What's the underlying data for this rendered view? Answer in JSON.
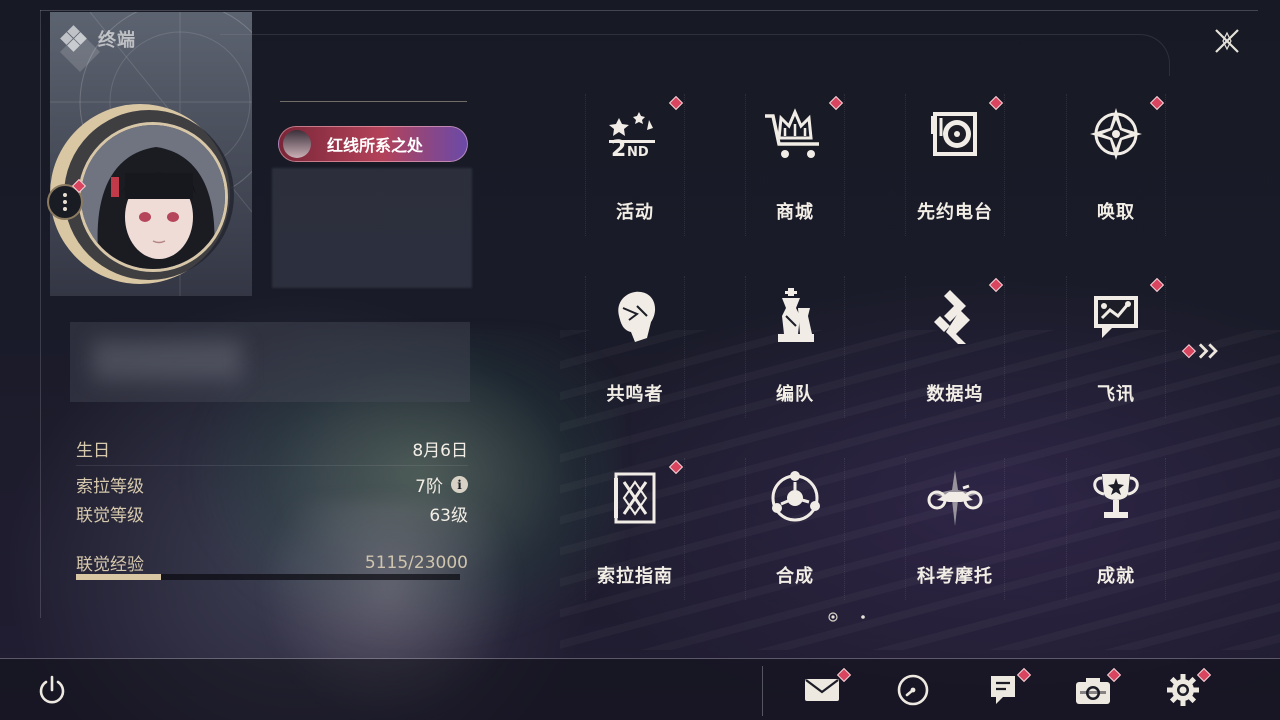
{
  "header": {
    "title": "终端"
  },
  "profile": {
    "title_badge": "红线所系之处",
    "stats": [
      {
        "label": "生日",
        "value": "8月6日"
      },
      {
        "label": "索拉等级",
        "value": "7阶"
      },
      {
        "label": "联觉等级",
        "value": "63级"
      }
    ],
    "exp": {
      "label": "联觉经验",
      "current": 5115,
      "max": 23000,
      "display": "5115/23000"
    }
  },
  "menu": {
    "items": [
      {
        "label": "活动",
        "icon": "event-2nd-icon",
        "badge": true
      },
      {
        "label": "商城",
        "icon": "crown-cart-icon",
        "badge": true
      },
      {
        "label": "先约电台",
        "icon": "radio-turntable-icon",
        "badge": true
      },
      {
        "label": "唤取",
        "icon": "compass-star-icon",
        "badge": true
      },
      {
        "label": "共鸣者",
        "icon": "resonator-head-icon",
        "badge": false
      },
      {
        "label": "编队",
        "icon": "chess-team-icon",
        "badge": false
      },
      {
        "label": "数据坞",
        "icon": "data-dock-icon",
        "badge": true
      },
      {
        "label": "飞讯",
        "icon": "chat-bubble-icon",
        "badge": true
      },
      {
        "label": "索拉指南",
        "icon": "guide-book-icon",
        "badge": true
      },
      {
        "label": "合成",
        "icon": "synthesis-ring-icon",
        "badge": false
      },
      {
        "label": "科考摩托",
        "icon": "motorbike-icon",
        "badge": false
      },
      {
        "label": "成就",
        "icon": "trophy-icon",
        "badge": false
      }
    ],
    "pages": {
      "current": 1,
      "total": 2
    }
  },
  "bottom_bar": {
    "buttons": [
      {
        "icon": "mail-icon",
        "badge": true
      },
      {
        "icon": "clock-icon",
        "badge": false
      },
      {
        "icon": "notice-icon",
        "badge": true
      },
      {
        "icon": "camera-icon",
        "badge": true
      },
      {
        "icon": "gear-icon",
        "badge": true
      }
    ]
  },
  "colors": {
    "accent_gold": "#d9c7a4",
    "badge_red": "#d9455f",
    "text_light": "#f2eee6"
  }
}
